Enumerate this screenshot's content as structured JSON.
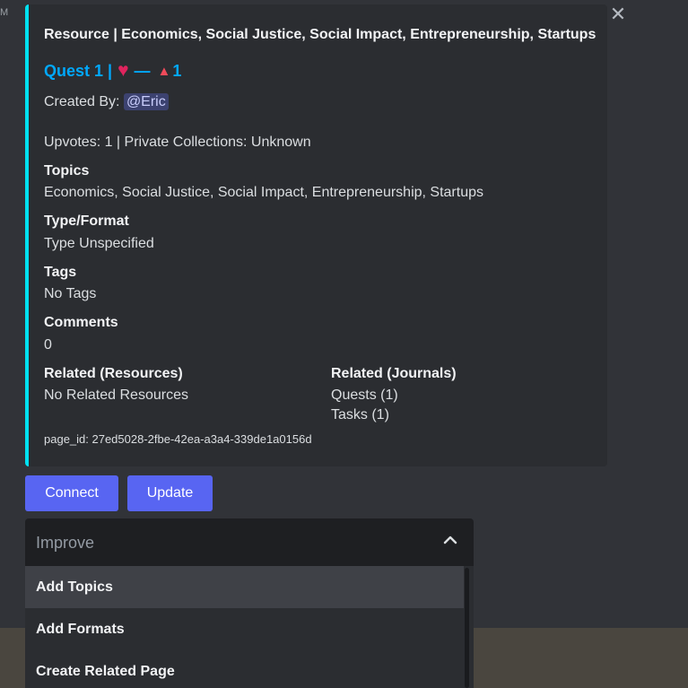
{
  "corner_text": "M",
  "close_glyph": "✕",
  "embed": {
    "title": "Resource | Economics, Social Justice, Social Impact, Entrepreneurship, Startups",
    "quest": "Quest 1 |",
    "heart_glyph": "♥",
    "dash": "—",
    "upvote_glyph": "▲",
    "upvote_count": "1",
    "created_by_label": "Created By:",
    "created_by_user": "@Eric",
    "stats": "Upvotes: 1 | Private Collections: Unknown",
    "topics_header": "Topics",
    "topics_value": "Economics, Social Justice, Social Impact, Entrepreneurship, Startups",
    "type_header": "Type/Format",
    "type_value": "Type Unspecified",
    "tags_header": "Tags",
    "tags_value": "No Tags",
    "comments_header": "Comments",
    "comments_value": "0",
    "related_resources_header": "Related (Resources)",
    "related_resources_value": "No Related Resources",
    "related_journals_header": "Related (Journals)",
    "related_journals_values": [
      "Quests (1)",
      "Tasks (1)"
    ],
    "page_id": "page_id: 27ed5028-2fbe-42ea-a3a4-339de1a0156d",
    "accent_color": "#00e1f0"
  },
  "buttons": {
    "connect": "Connect",
    "update": "Update"
  },
  "dropdown": {
    "label": "Improve",
    "chevron_icon": "chevron-up-icon",
    "items": [
      "Add Topics",
      "Add Formats",
      "Create Related Page"
    ]
  }
}
